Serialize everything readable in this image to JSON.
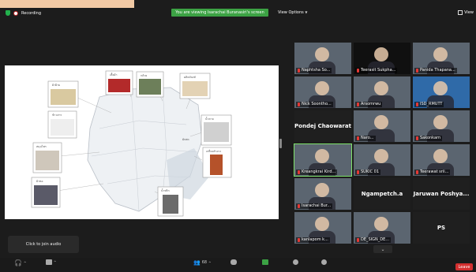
{
  "app": {
    "recording_label": "Recording",
    "banner": "You are viewing Isarachai Buranasiri's screen",
    "view_options": "View Options",
    "view_mode": "View"
  },
  "presentation": {
    "labels": [
      "ผ้าฝ้าย",
      "เสื้อผ้า",
      "กล้วย",
      "ผลิตภัณฑ์",
      "ข้าวสาร",
      "น้ำตาล",
      "สมุนไพร",
      "เครื่องสำอาง",
      "ผ้าทอ",
      "น้ำพริก",
      "ผักสด"
    ]
  },
  "participants": [
    {
      "name": "Naphtsha So...",
      "style": "video"
    },
    {
      "name": "Teerasit Sukpha...",
      "style": "video-dark"
    },
    {
      "name": "Panida Thapana...",
      "style": "video"
    },
    {
      "name": "Nick Soontho...",
      "style": "video"
    },
    {
      "name": "Arsomrwu",
      "style": "video"
    },
    {
      "name": "ISD_RMUTT",
      "style": "video-blue"
    },
    {
      "name": "Pondej Chaowarat",
      "style": "text"
    },
    {
      "name": "Naro...",
      "style": "video"
    },
    {
      "name": "Sakonkarn",
      "style": "video"
    },
    {
      "name": "Kreangkrai Kird...",
      "style": "video"
    },
    {
      "name": "SUKIC 01",
      "style": "video"
    },
    {
      "name": "Teerawat srii...",
      "style": "video"
    },
    {
      "name": "Isarachai Bur...",
      "style": "video"
    },
    {
      "name": "Ngampetch.a",
      "style": "text"
    },
    {
      "name": "Jaruwan Poshya...",
      "style": "text"
    },
    {
      "name": "kanlapom k...",
      "style": "video"
    },
    {
      "name": "DE_SIGN_DE...",
      "style": "video"
    },
    {
      "name": "PS",
      "style": "text"
    }
  ],
  "join_audio": "Click to join audio",
  "controls": {
    "participants_count": "68",
    "leave": "Leave"
  }
}
